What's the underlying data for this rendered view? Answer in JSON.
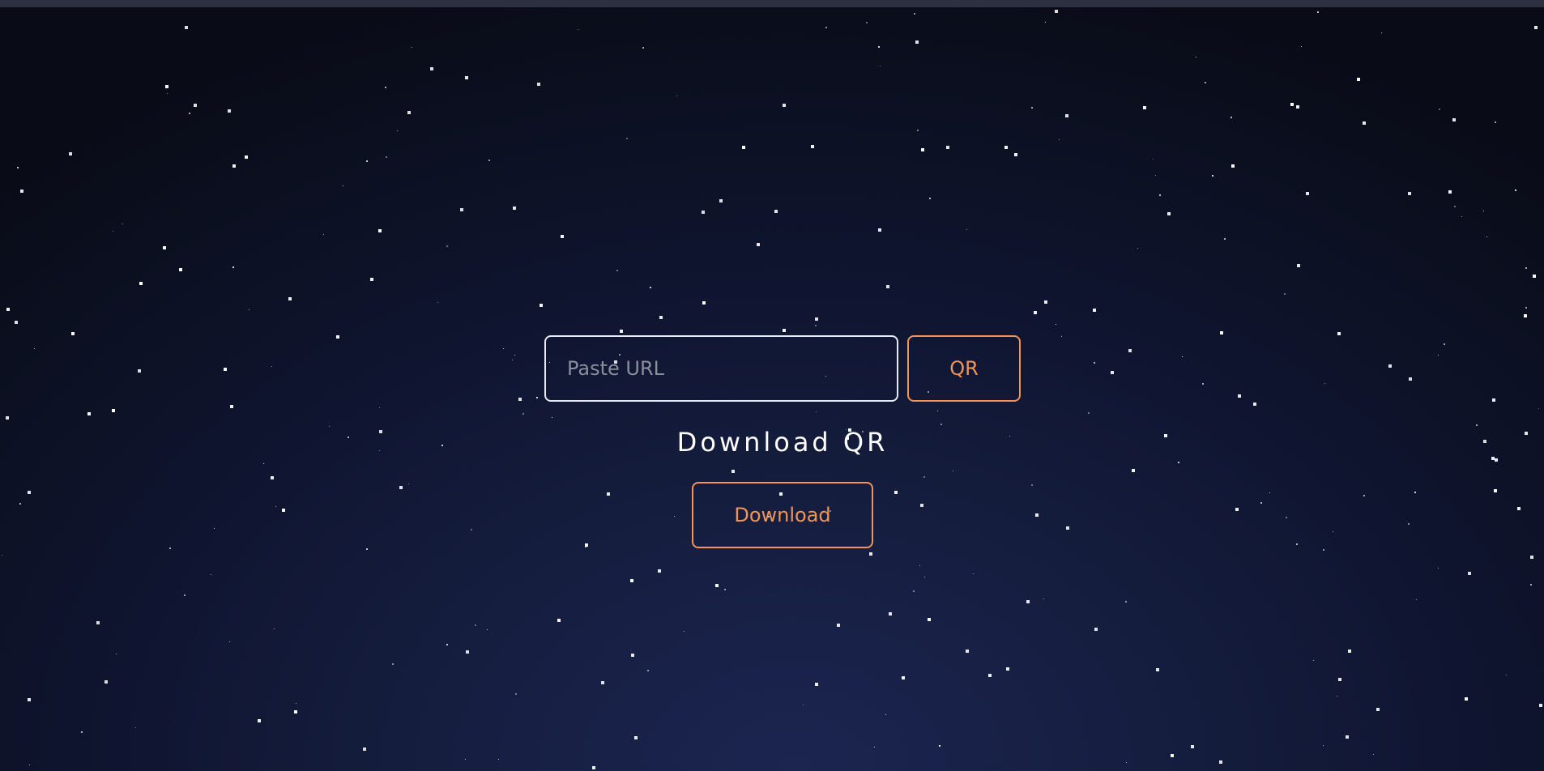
{
  "form": {
    "url_placeholder": "Paste URL",
    "url_value": "",
    "qr_button_label": "QR"
  },
  "download": {
    "title": "Download QR",
    "button_label": "Download"
  },
  "colors": {
    "accent": "#f0945a",
    "input_border": "#e9ecf5",
    "background_center": "#1b2550",
    "background_edge": "#090c17",
    "top_bar": "#2c3040"
  }
}
